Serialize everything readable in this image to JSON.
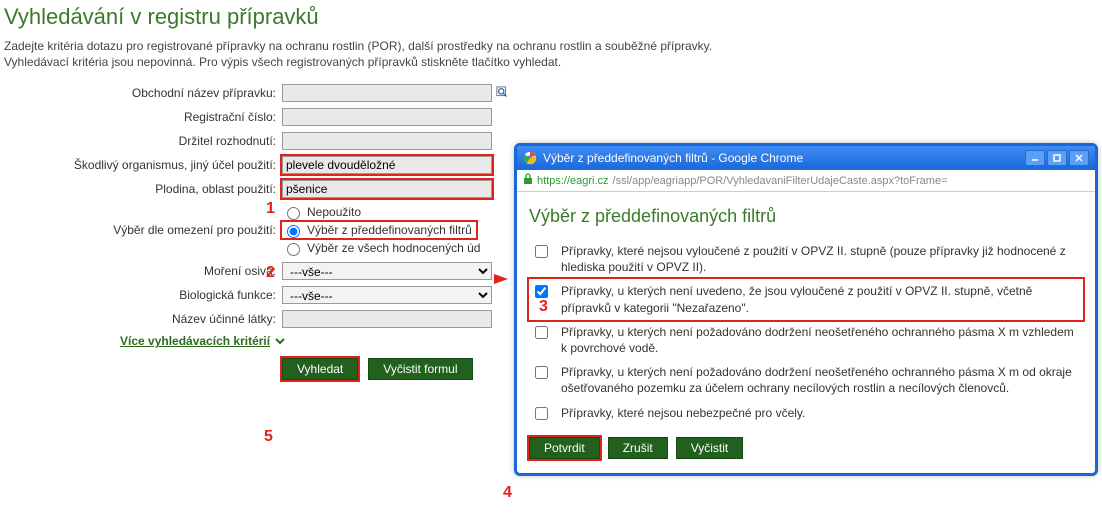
{
  "page": {
    "title": "Vyhledávání v registru přípravků",
    "intro1": "Zadejte kritéria dotazu pro registrované přípravky na ochranu rostlin (POR), další prostředky na ochranu rostlin a souběžné přípravky.",
    "intro2": "Vyhledávací kritéria jsou nepovinná. Pro výpis všech registrovaných přípravků stiskněte tlačítko vyhledat."
  },
  "form": {
    "labels": {
      "trade_name": "Obchodní název přípravku:",
      "reg_num": "Registrační číslo:",
      "holder": "Držitel rozhodnutí:",
      "pest": "Škodlivý organismus, jiný účel použití:",
      "crop": "Plodina, oblast použití:",
      "restrict": "Výběr dle omezení pro použití:",
      "seed": "Moření osiva:",
      "biofunc": "Biologická funkce:",
      "substance": "Název účinné látky:"
    },
    "values": {
      "trade_name": "",
      "reg_num": "",
      "holder": "",
      "pest": "plevele dvouděložné",
      "crop": "pšenice",
      "seed": "---vše---",
      "biofunc": "---vše---",
      "substance": ""
    },
    "radios": {
      "opt1": "Nepoužito",
      "opt2": "Výběr z předdefinovaných filtrů",
      "opt3": "Výběr ze všech hodnocených úd"
    },
    "more": "Více vyhledávacích kritérií",
    "btn_search": "Vyhledat",
    "btn_clear": "Vyčistit formul"
  },
  "markers": {
    "m1": "1",
    "m2": "2",
    "m3": "3",
    "m4": "4",
    "m5": "5"
  },
  "popup": {
    "window_title": "Výběr z předdefinovaných filtrů - Google Chrome",
    "url_host": "https://eagri.cz",
    "url_path": "/ssl/app/eagriapp/POR/VyhledavaniFilterUdajeCaste.aspx?toFrame=",
    "heading": "Výběr z předdefinovaných filtrů",
    "filters": {
      "f1": "Přípravky, které nejsou vyloučené z použití v OPVZ II. stupně (pouze přípravky již hodnocené z hlediska použití v OPVZ II).",
      "f2": "Přípravky, u kterých není uvedeno, že jsou vyloučené z použití v OPVZ II. stupně, včetně přípravků v kategorii \"Nezařazeno\".",
      "f3": "Přípravky, u kterých není požadováno dodržení neošetřeného ochranného pásma X m vzhledem k povrchové vodě.",
      "f4": "Přípravky, u kterých není požadováno dodržení neošetřeného ochranného pásma X m od okraje ošetřovaného pozemku za účelem ochrany necílových rostlin a necílových členovců.",
      "f5": "Přípravky, které nejsou nebezpečné pro včely."
    },
    "btn_confirm": "Potvrdit",
    "btn_cancel": "Zrušit",
    "btn_clear": "Vyčistit"
  }
}
